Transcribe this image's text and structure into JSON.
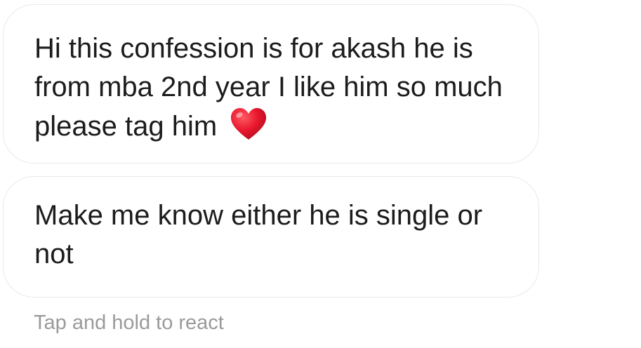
{
  "messages": [
    {
      "text": "Hi this confession is for akash he is from mba 2nd year I like him so much please tag him",
      "trailing_emoji": "red-heart-icon"
    },
    {
      "text": "Make me know either he is single or not"
    }
  ],
  "hint": "Tap and hold to react",
  "colors": {
    "background": "#ffffff",
    "bubble_border": "#e9e9e9",
    "text": "#1c1c1c",
    "hint": "#9a9a9a",
    "heart": "#e0142b"
  }
}
